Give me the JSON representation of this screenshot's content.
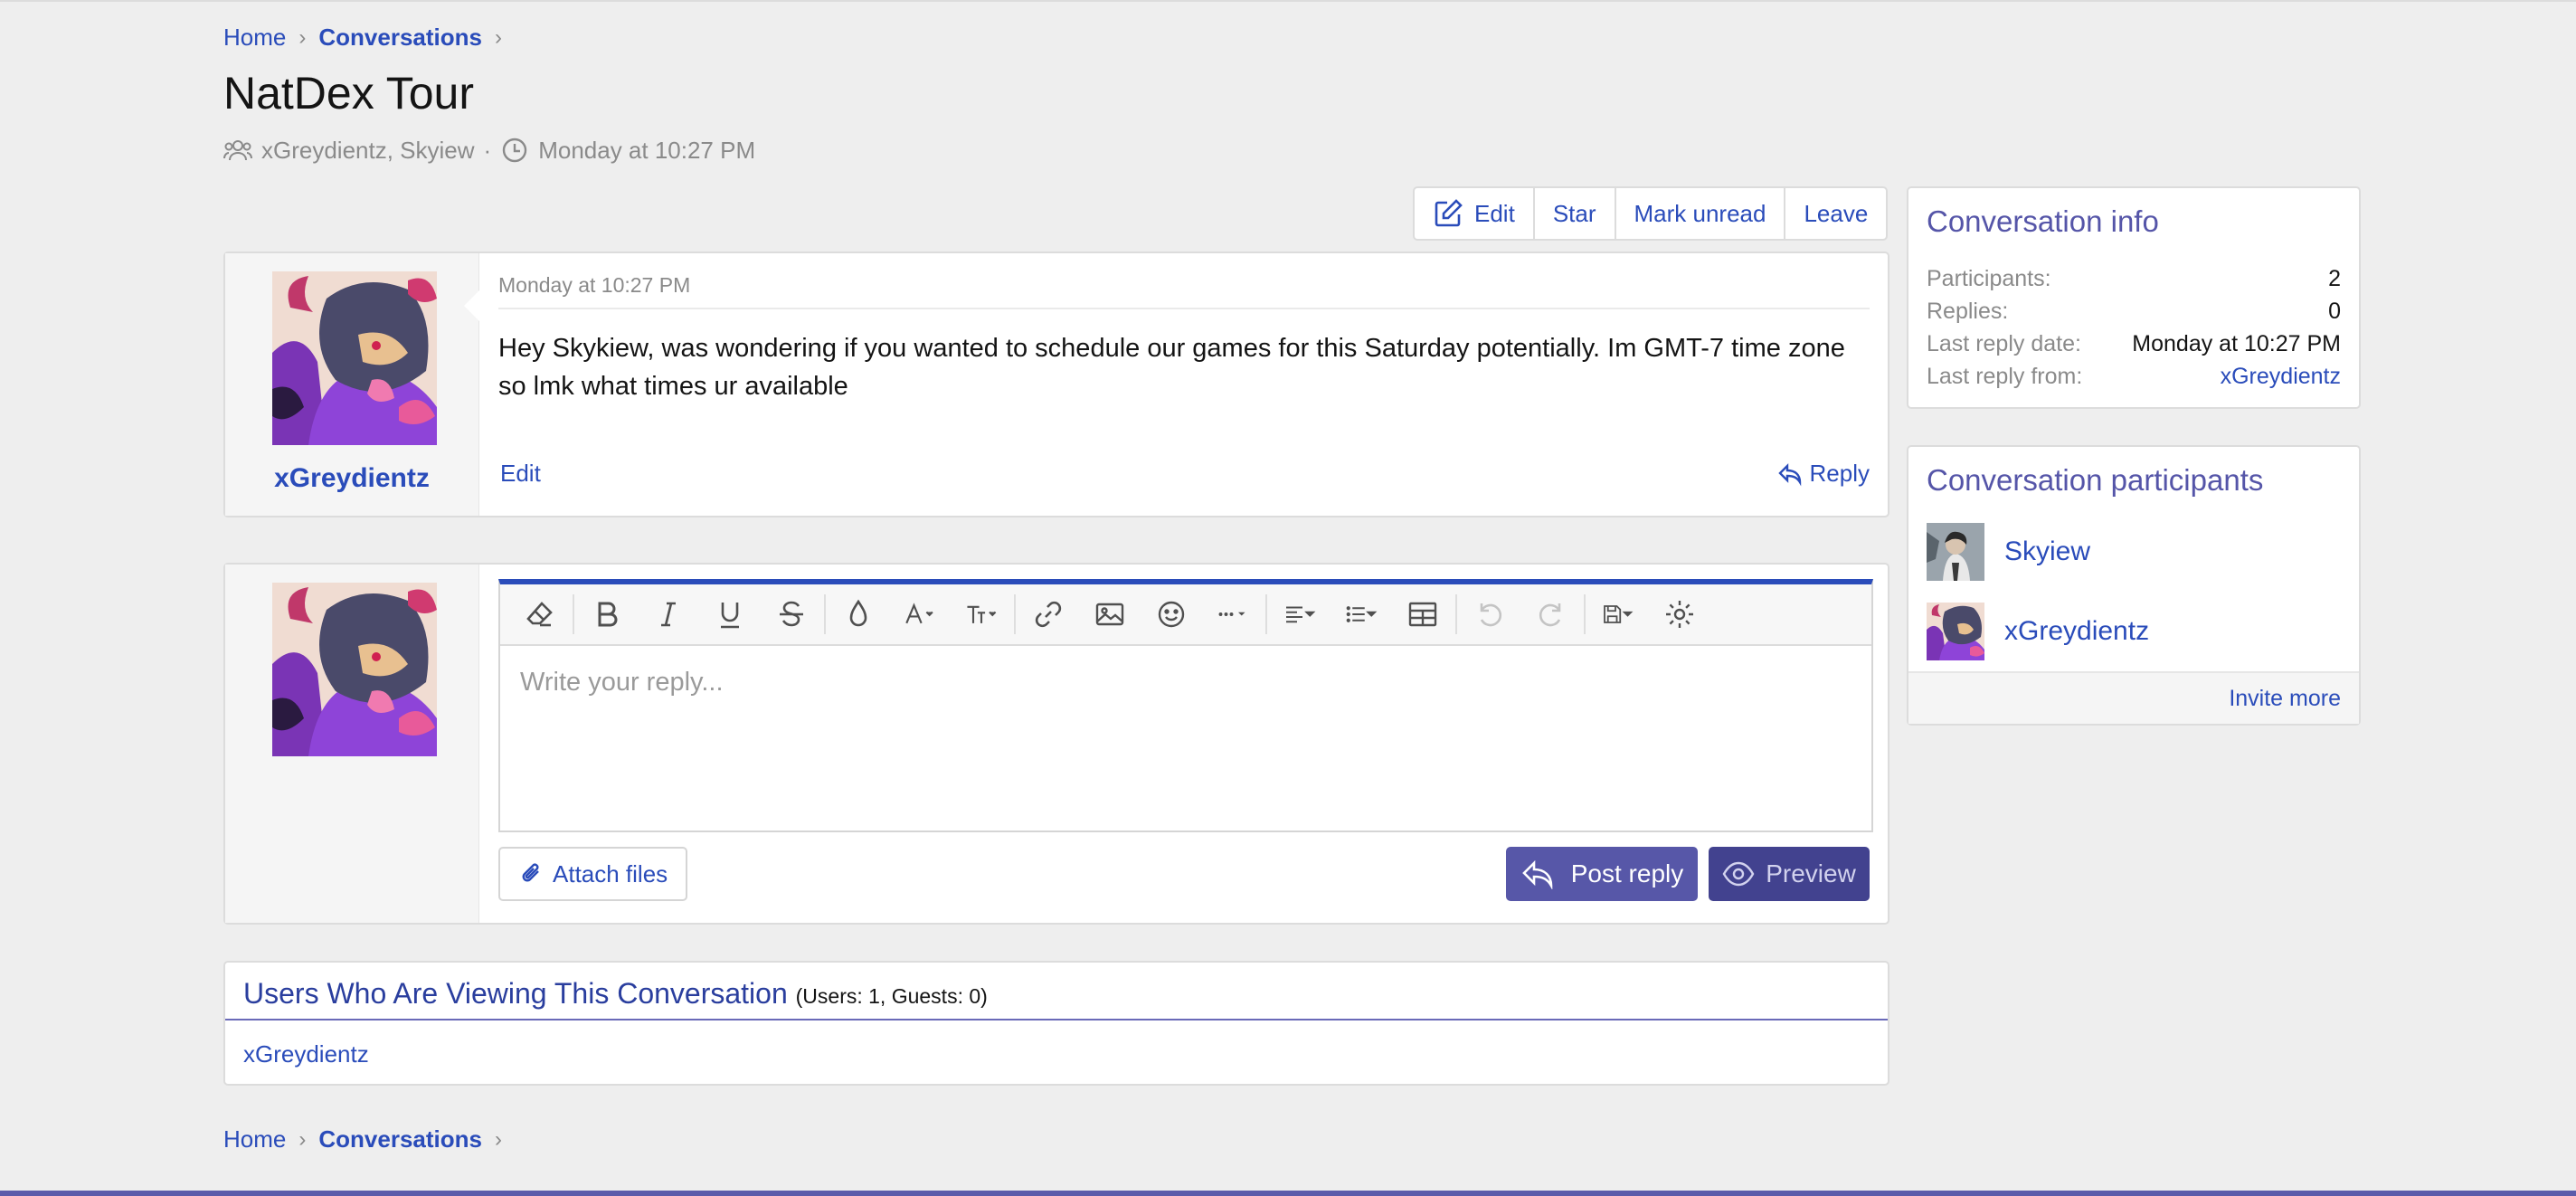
{
  "breadcrumb": {
    "home": "Home",
    "conversations": "Conversations",
    "sep": "›"
  },
  "page": {
    "title": "NatDex Tour",
    "participants_text": "xGreydientz, Skyiew",
    "dot": "·",
    "date": "Monday at 10:27 PM"
  },
  "actions": {
    "edit": "Edit",
    "star": "Star",
    "mark_unread": "Mark unread",
    "leave": "Leave"
  },
  "message": {
    "author": "xGreydientz",
    "date": "Monday at 10:27 PM",
    "body": "Hey Skykiew, was wondering if you wanted to schedule our games for this Saturday potentially. Im GMT-7 time zone so lmk what times ur available",
    "edit_label": "Edit",
    "reply_label": "Reply"
  },
  "reply_editor": {
    "placeholder": "Write your reply...",
    "attach_label": "Attach files",
    "post_label": "Post reply",
    "preview_label": "Preview"
  },
  "viewing": {
    "title": "Users Who Are Viewing This Conversation",
    "counts": "(Users: 1, Guests: 0)",
    "users": "xGreydientz"
  },
  "conversation_info": {
    "title": "Conversation info",
    "rows": [
      {
        "label": "Participants:",
        "value": "2"
      },
      {
        "label": "Replies:",
        "value": "0"
      },
      {
        "label": "Last reply date:",
        "value": "Monday at 10:27 PM"
      },
      {
        "label": "Last reply from:",
        "value": "xGreydientz"
      }
    ]
  },
  "participants_panel": {
    "title": "Conversation participants",
    "users": [
      "Skyiew",
      "xGreydientz"
    ],
    "invite_label": "Invite more"
  },
  "colors": {
    "link": "#2a4cba",
    "accent": "#5757a8",
    "accent_dark": "#42428f",
    "background": "#eeeeee"
  }
}
